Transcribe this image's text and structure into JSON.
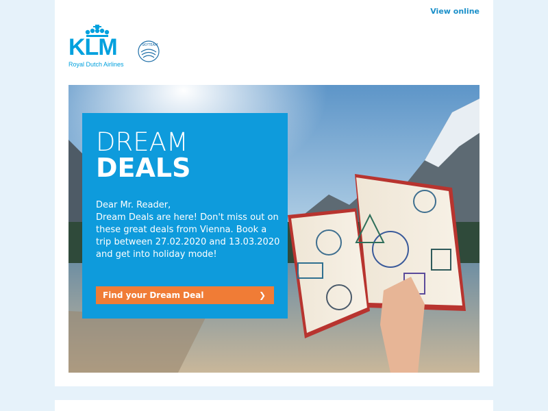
{
  "header": {
    "view_online": "View online",
    "logo_text": "KLM",
    "logo_subtitle": "Royal Dutch Airlines",
    "alliance_text": "SKYTEAM"
  },
  "promo": {
    "title_line1": "DREAM",
    "title_line2": "DEALS",
    "greeting": "Dear Mr. Reader,",
    "body": "Dream Deals are here! Don't miss out on these great deals from Vienna. Book a trip between 27.02.2020 and 13.03.2020 and get into holiday mode!",
    "cta_label": "Find your Dream Deal",
    "cta_icon": "chevron-right-icon"
  },
  "colors": {
    "page_bg": "#e6f2fa",
    "brand_blue": "#00a1de",
    "promo_blue": "#0e9bdc",
    "cta_orange": "#f07c36"
  }
}
